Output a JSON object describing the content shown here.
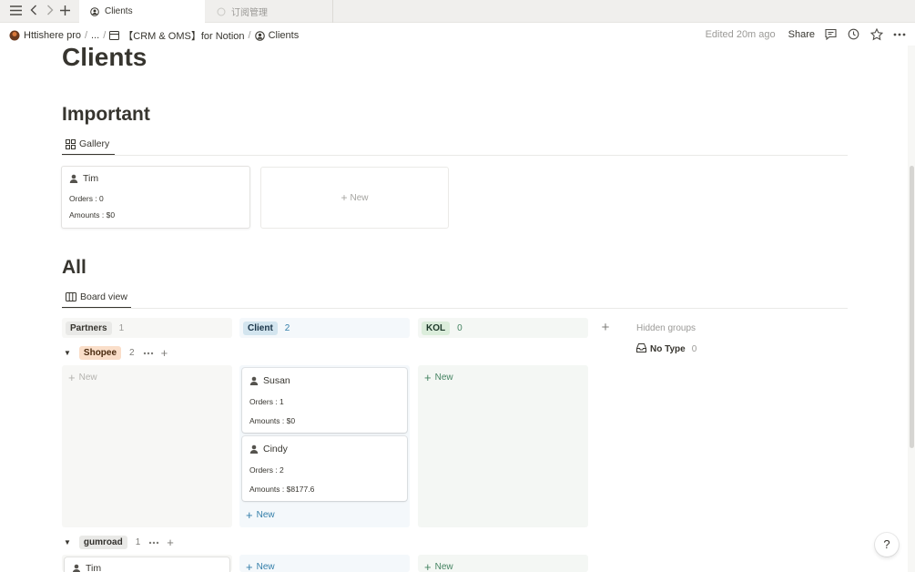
{
  "tabs": [
    {
      "label": "Clients",
      "active": true
    },
    {
      "label": "订阅管理",
      "active": false
    }
  ],
  "breadcrumb": {
    "workspace": "Httishere pro",
    "ellipsis": "...",
    "parent": "【CRM & OMS】for Notion",
    "current": "Clients"
  },
  "topbar": {
    "edited": "Edited 20m ago",
    "share": "Share"
  },
  "page": {
    "title": "Clients"
  },
  "important": {
    "heading": "Important",
    "view_label": "Gallery",
    "cards": [
      {
        "name": "Tim",
        "orders": "Orders : 0",
        "amounts": "Amounts : $0"
      }
    ],
    "new_label": "New"
  },
  "all": {
    "heading": "All",
    "view_label": "Board view",
    "columns": [
      {
        "name": "Partners",
        "count": "1",
        "pill_bg": "#e9e9e7",
        "pill_color": "#37352f",
        "count_color": "#9b9a97",
        "head_bg": "#f7f7f5"
      },
      {
        "name": "Client",
        "count": "2",
        "pill_bg": "#d3e5ef",
        "pill_color": "#183347",
        "count_color": "#337ea9",
        "head_bg": "#f4f8fb"
      },
      {
        "name": "KOL",
        "count": "0",
        "pill_bg": "#dbeddb",
        "pill_color": "#1c3829",
        "count_color": "#448361",
        "head_bg": "#f4f7f4"
      }
    ],
    "hidden_groups_label": "Hidden groups",
    "hidden_groups": [
      {
        "name": "No Type",
        "count": "0"
      }
    ],
    "groups": [
      {
        "name": "Shopee",
        "count": "2",
        "pill_bg": "#fadec9",
        "pill_color": "#49290e",
        "partners_new": "New",
        "client_cards": [
          {
            "name": "Susan",
            "orders": "Orders : 1",
            "amounts": "Amounts : $0"
          },
          {
            "name": "Cindy",
            "orders": "Orders : 2",
            "amounts": "Amounts : $8177.6"
          }
        ],
        "client_new": "New",
        "kol_new": "New"
      },
      {
        "name": "gumroad",
        "count": "1",
        "pill_bg": "#e9e9e7",
        "pill_color": "#32302c",
        "partners_cards": [
          {
            "name": "Tim"
          }
        ],
        "client_new": "New",
        "kol_new": "New"
      }
    ]
  },
  "help_label": "?"
}
